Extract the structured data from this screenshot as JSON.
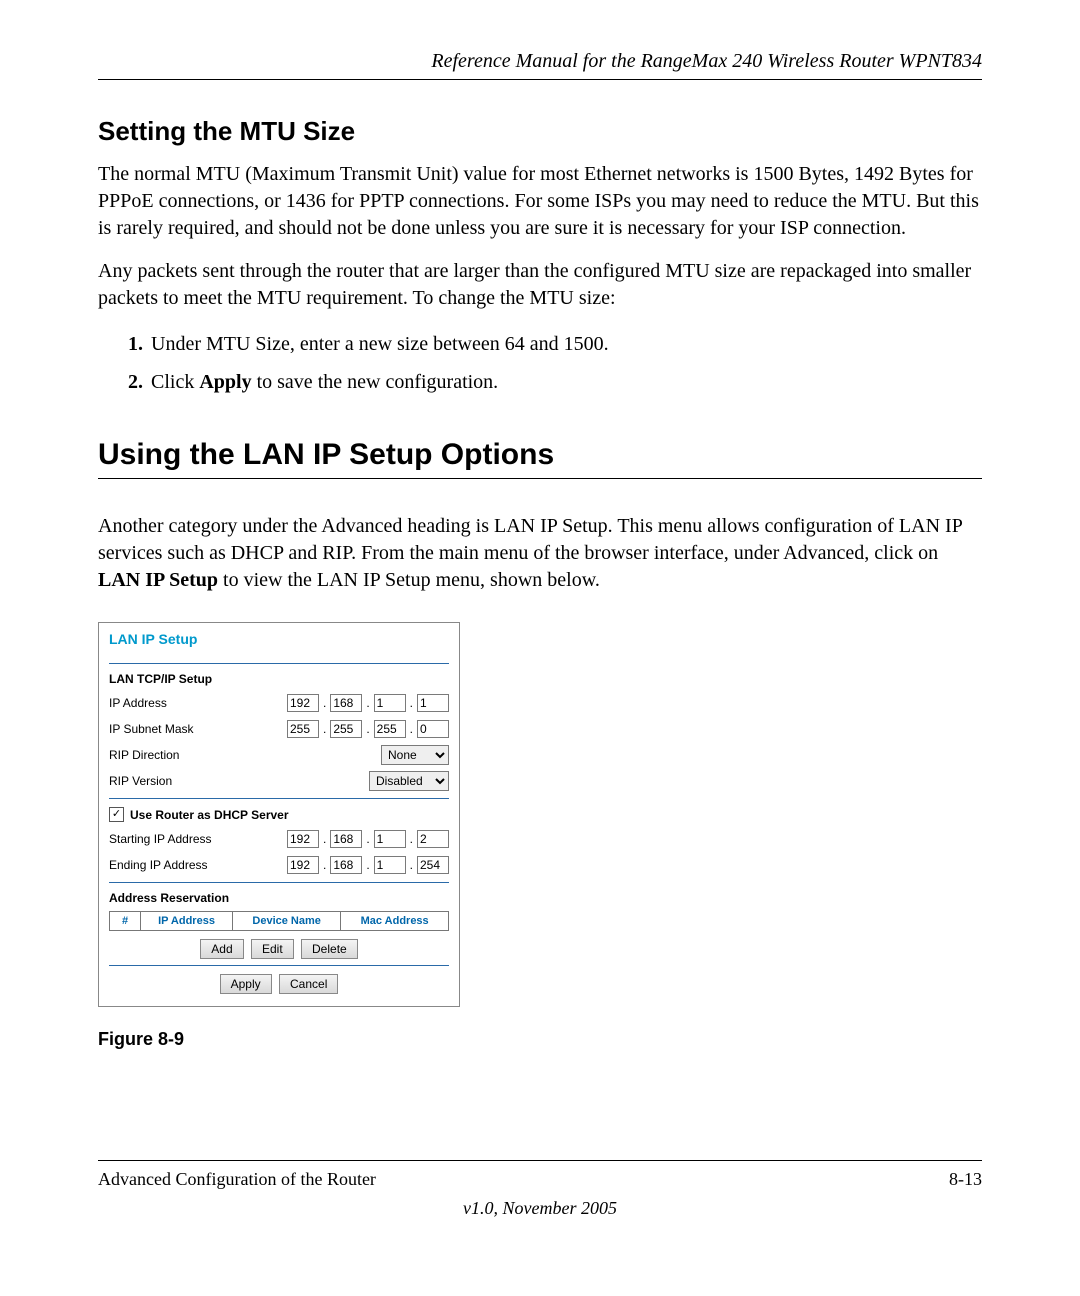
{
  "header": {
    "title": "Reference Manual for the RangeMax 240 Wireless Router WPNT834"
  },
  "section_mtu": {
    "heading": "Setting the MTU Size",
    "para1": "The normal MTU (Maximum Transmit Unit) value for most Ethernet networks is 1500 Bytes, 1492 Bytes for PPPoE connections, or 1436 for PPTP connections. For some ISPs you may need to reduce the MTU. But this is rarely required, and should not be done unless you are sure it is necessary for your ISP connection.",
    "para2": "Any packets sent through the router that are larger than the configured MTU size are repackaged into smaller packets to meet the MTU requirement. To change the MTU size:",
    "step1_num": "1.",
    "step1_text": "Under MTU Size, enter a new size between 64 and 1500.",
    "step2_num": "2.",
    "step2_pre": "Click ",
    "step2_bold": "Apply",
    "step2_post": " to save the new configuration."
  },
  "section_lan": {
    "heading": "Using the LAN IP Setup Options",
    "para_pre": "Another category under the Advanced heading is LAN IP Setup. This menu allows configuration of LAN IP services such as DHCP and RIP. From the main menu of the browser interface, under Advanced, click on ",
    "para_bold": "LAN IP Setup",
    "para_post": " to view the LAN IP Setup menu, shown below."
  },
  "panel": {
    "title": "LAN IP Setup",
    "tcpip_head": "LAN TCP/IP Setup",
    "ip_label": "IP Address",
    "ip": [
      "192",
      "168",
      "1",
      "1"
    ],
    "mask_label": "IP Subnet Mask",
    "mask": [
      "255",
      "255",
      "255",
      "0"
    ],
    "rip_dir_label": "RIP Direction",
    "rip_dir_value": "None",
    "rip_ver_label": "RIP Version",
    "rip_ver_value": "Disabled",
    "dhcp_check_label": "Use Router as DHCP Server",
    "dhcp_checked": "✓",
    "start_label": "Starting IP Address",
    "start": [
      "192",
      "168",
      "1",
      "2"
    ],
    "end_label": "Ending IP Address",
    "end": [
      "192",
      "168",
      "1",
      "254"
    ],
    "reservation_head": "Address Reservation",
    "th_num": "#",
    "th_ip": "IP Address",
    "th_dev": "Device Name",
    "th_mac": "Mac Address",
    "btn_add": "Add",
    "btn_edit": "Edit",
    "btn_delete": "Delete",
    "btn_apply": "Apply",
    "btn_cancel": "Cancel"
  },
  "figure_caption": "Figure 8-9",
  "footer": {
    "left": "Advanced Configuration of the Router",
    "right": "8-13",
    "version": "v1.0, November 2005"
  }
}
